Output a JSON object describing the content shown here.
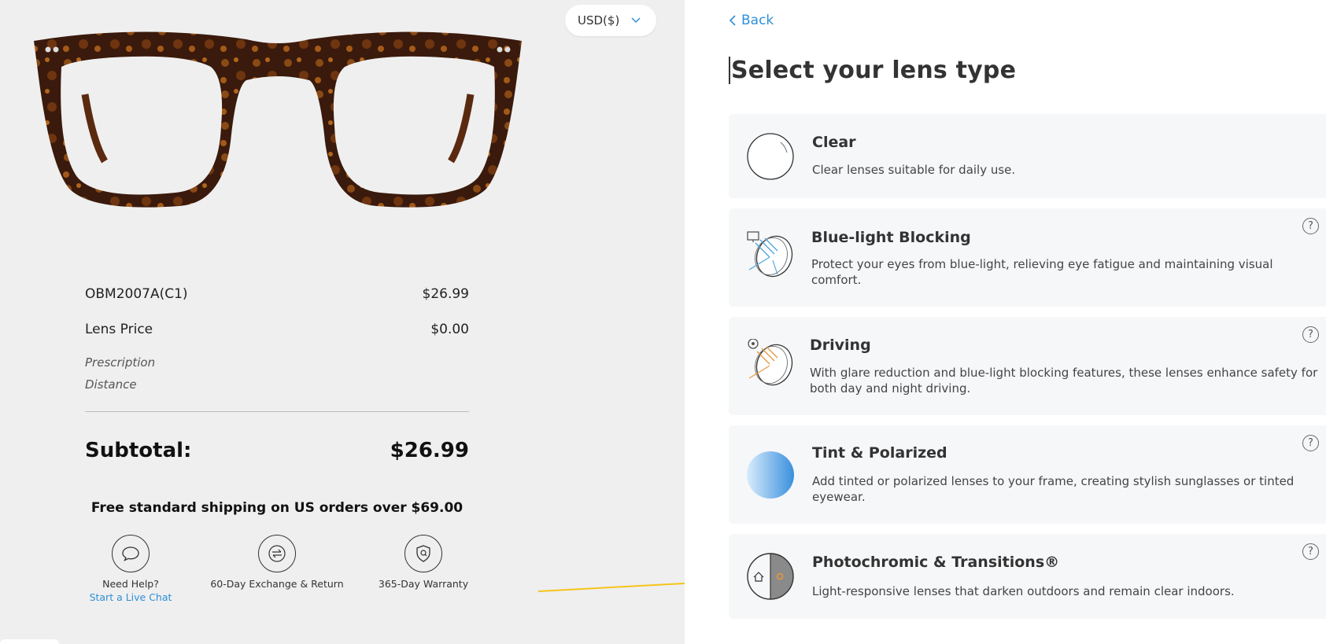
{
  "currency": {
    "label": "USD($)"
  },
  "summary": {
    "frame_name": "OBM2007A(C1)",
    "frame_price": "$26.99",
    "lens_label": "Lens Price",
    "lens_price": "$0.00",
    "prescription_label": "Prescription",
    "distance_label": "Distance",
    "subtotal_label": "Subtotal:",
    "subtotal_value": "$26.99",
    "shipping_text": "Free standard shipping on US orders over $69.00"
  },
  "features": [
    {
      "label": "Need Help?",
      "link": "Start a Live Chat",
      "icon": "chat-icon"
    },
    {
      "label": "60-Day Exchange & Return",
      "icon": "exchange-icon"
    },
    {
      "label": "365-Day Warranty",
      "icon": "warranty-shield-icon"
    }
  ],
  "lens": {
    "back_label": "Back",
    "title": "Select your lens type",
    "options": [
      {
        "name": "Clear",
        "desc": "Clear lenses suitable for daily use.",
        "icon": "clear-lens-icon"
      },
      {
        "name": "Blue-light Blocking",
        "desc": "Protect your eyes from blue-light, relieving eye fatigue and maintaining visual comfort.",
        "icon": "blue-light-lens-icon"
      },
      {
        "name": "Driving",
        "desc": "With glare reduction and blue-light blocking features, these lenses enhance safety for both day and night driving.",
        "icon": "driving-lens-icon"
      },
      {
        "name": "Tint & Polarized",
        "desc": "Add tinted or polarized lenses to your frame, creating stylish sunglasses or tinted eyewear.",
        "icon": "tint-lens-icon"
      },
      {
        "name": "Photochromic & Transitions®",
        "desc": "Light-responsive lenses that darken outdoors and remain clear indoors.",
        "icon": "photochromic-lens-icon"
      }
    ],
    "help_glyph": "?"
  },
  "colors": {
    "accent": "#2f8fd8",
    "annotation_arrow": "#f5c518"
  }
}
